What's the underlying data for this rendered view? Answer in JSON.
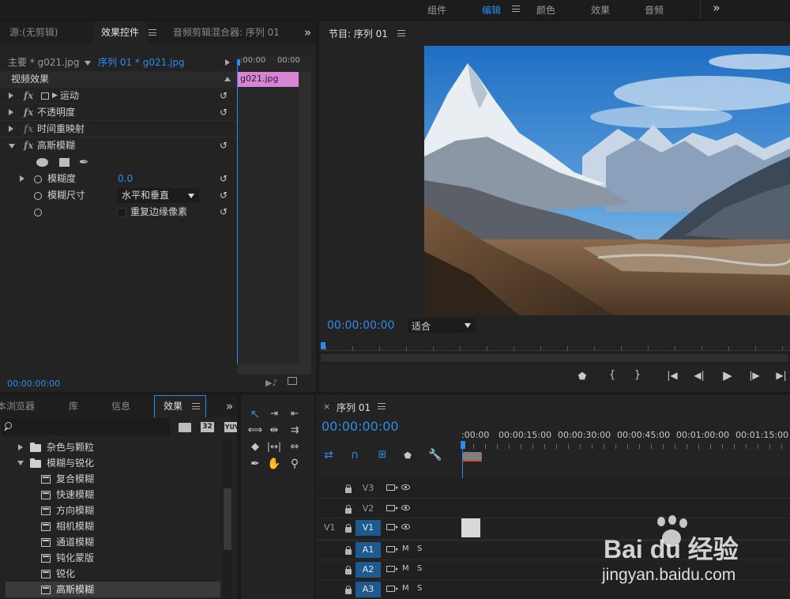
{
  "topbar": {
    "workspaces": [
      "组件",
      "编辑",
      "颜色",
      "效果",
      "音频"
    ],
    "active_workspace": "编辑",
    "overflow": "»"
  },
  "effect_controls": {
    "tabs": [
      "源:(无剪辑)",
      "效果控件",
      "音频剪辑混合器: 序列 01"
    ],
    "active_tab": "效果控件",
    "overflow": "»",
    "master_label": "主要 * g021.jpg",
    "sequence_label": "序列 01 * g021.jpg",
    "ruler_times": [
      ":00:00",
      "00:00"
    ],
    "clip_name": "g021.jpg",
    "section_title": "视频效果",
    "effects": [
      {
        "name": "运动",
        "expanded": false,
        "has_fx": true,
        "has_reset": true
      },
      {
        "name": "不透明度",
        "expanded": false,
        "has_fx": true,
        "has_reset": true
      },
      {
        "name": "时间重映射",
        "expanded": false,
        "has_fx": true,
        "has_reset": false
      },
      {
        "name": "高斯模糊",
        "expanded": true,
        "has_fx": true,
        "has_reset": true
      }
    ],
    "params": {
      "blurriness_label": "模糊度",
      "blurriness_value": "0.0",
      "dimension_label": "模糊尺寸",
      "dimension_value": "水平和垂直",
      "repeat_edge_label": "重复边缘像素"
    },
    "timecode": "00:00:00:00"
  },
  "program_monitor": {
    "title": "节目: 序列 01",
    "timecode": "00:00:00:00",
    "fit_label": "适合",
    "controls": [
      "marker",
      "in-point",
      "out-point",
      "go-to-in",
      "step-back",
      "play",
      "step-forward",
      "go-to-out"
    ]
  },
  "effects_panel": {
    "tabs": [
      "本浏览器",
      "库",
      "信息",
      "效果"
    ],
    "active_tab": "效果",
    "overflow": "»",
    "search_placeholder": "",
    "tree": [
      {
        "type": "folder",
        "label": "杂色与颗粒",
        "expanded": false
      },
      {
        "type": "folder",
        "label": "模糊与锐化",
        "expanded": true
      },
      {
        "type": "effect",
        "label": "复合模糊"
      },
      {
        "type": "effect",
        "label": "快速模糊"
      },
      {
        "type": "effect",
        "label": "方向模糊"
      },
      {
        "type": "effect",
        "label": "相机模糊"
      },
      {
        "type": "effect",
        "label": "通道模糊"
      },
      {
        "type": "effect",
        "label": "钝化蒙版"
      },
      {
        "type": "effect",
        "label": "锐化"
      },
      {
        "type": "effect",
        "label": "高斯模糊",
        "selected": true
      }
    ],
    "filter_badges": [
      "32",
      "YUV"
    ]
  },
  "timeline": {
    "title": "序列 01",
    "timecode": "00:00:00:00",
    "ruler_labels": [
      ":00:00",
      "00:00:15:00",
      "00:00:30:00",
      "00:00:45:00",
      "00:01:00:00",
      "00:01:15:00"
    ],
    "video_tracks": [
      "V3",
      "V2",
      "V1"
    ],
    "audio_tracks": [
      "A1",
      "A2",
      "A3"
    ],
    "source_patch": "V1",
    "mute_label": "M",
    "solo_label": "S"
  },
  "watermark": {
    "logo": "Bai du 经验",
    "url": "jingyan.baidu.com"
  }
}
